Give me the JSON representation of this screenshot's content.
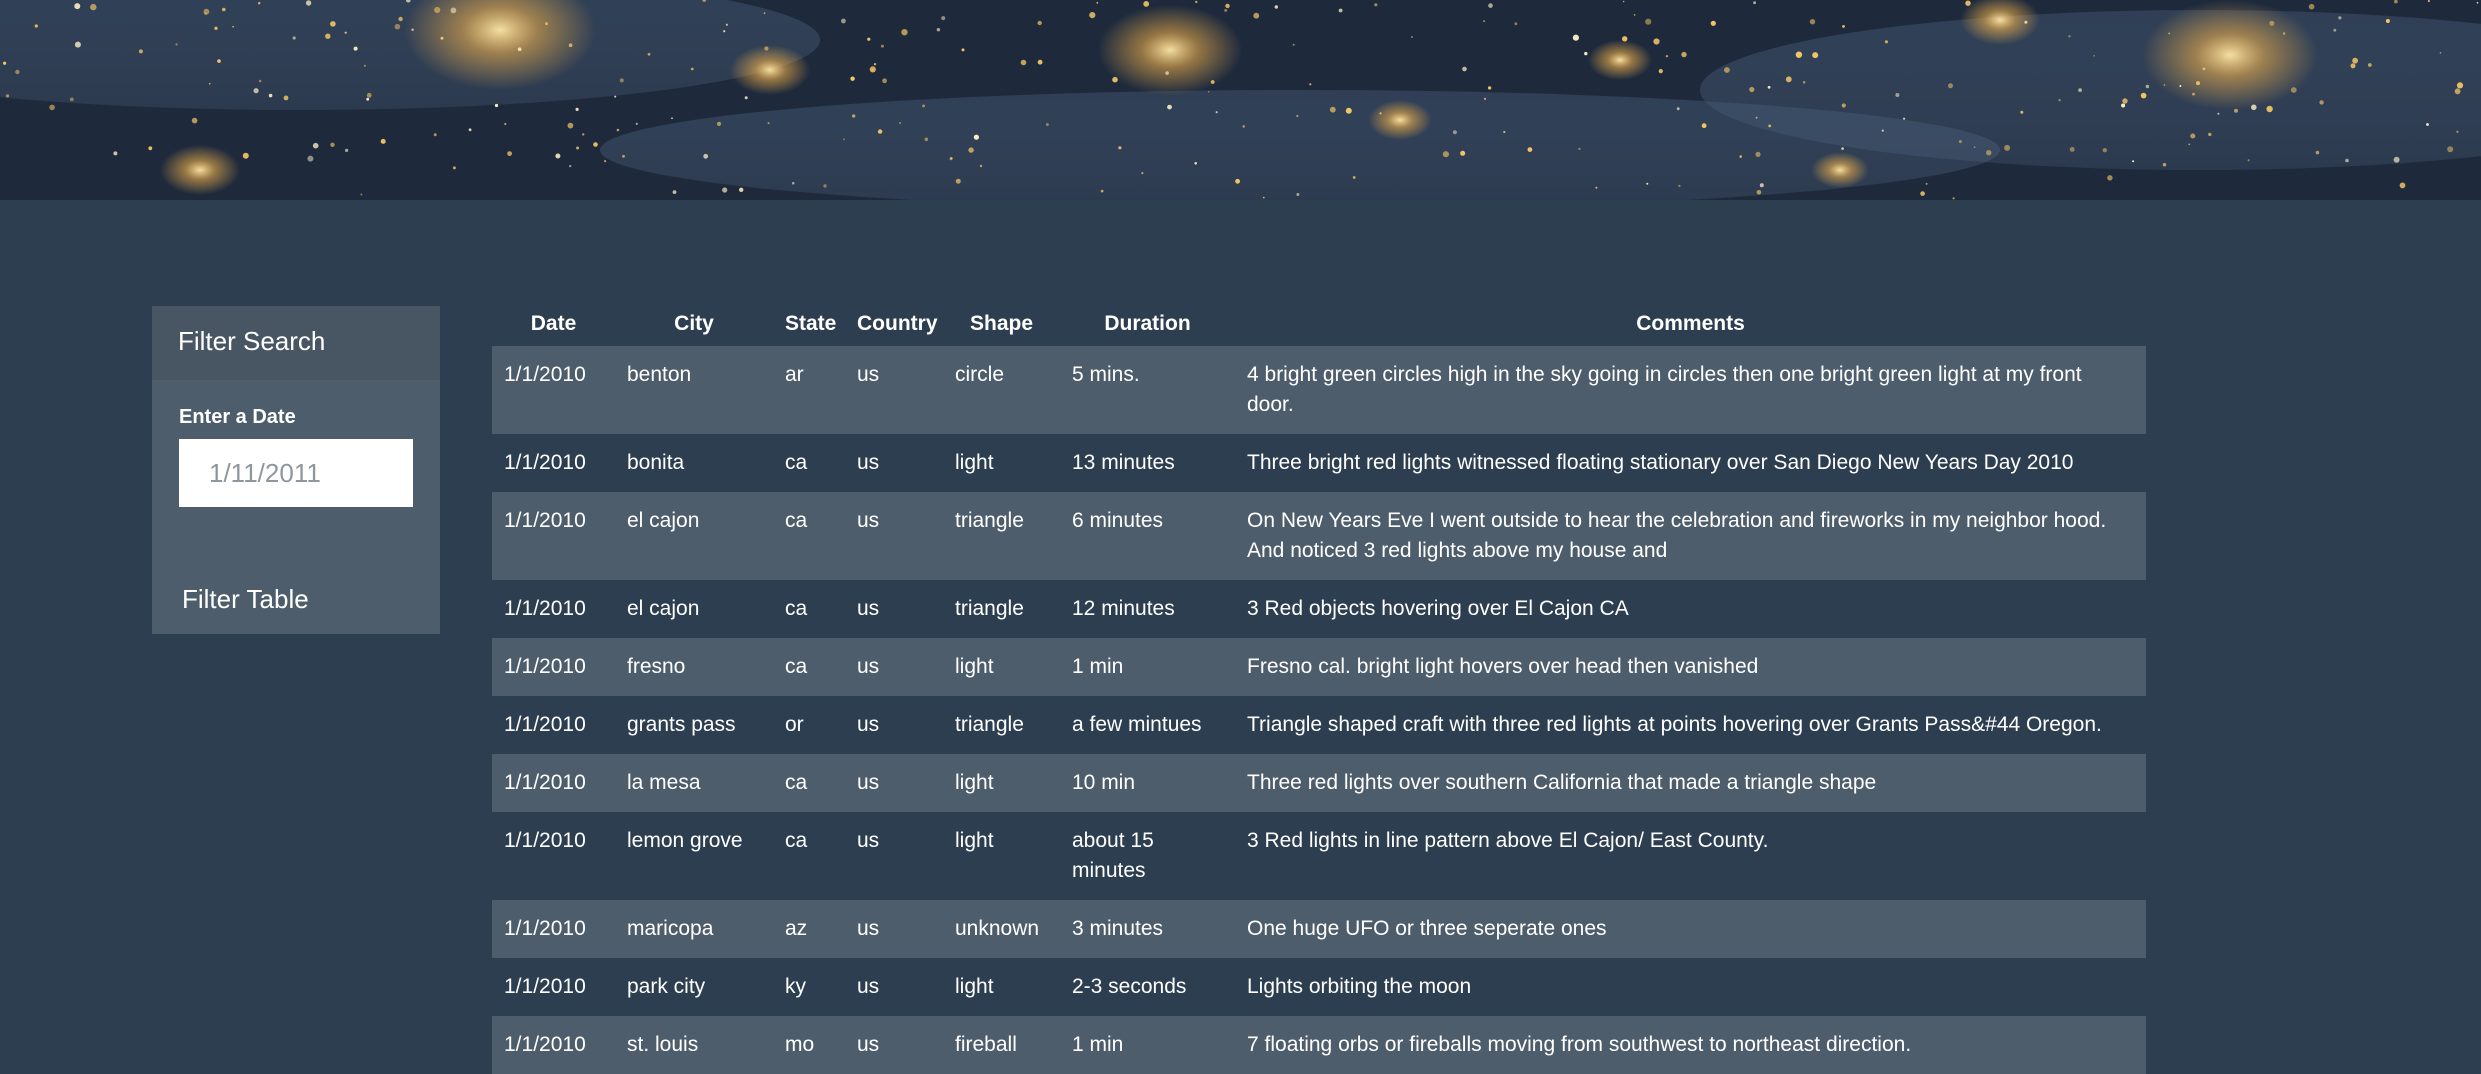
{
  "colors": {
    "page_background": "#2c3e50",
    "panel_background": "#4e5d6c",
    "row_alt": "#4e5d6c",
    "text": "#ffffff"
  },
  "hero": {
    "image": "night-earth-city-lights"
  },
  "filter": {
    "heading": "Filter Search",
    "label": "Enter a Date",
    "placeholder": "1/11/2011",
    "button_label": "Filter Table"
  },
  "table": {
    "headers": {
      "date": "Date",
      "city": "City",
      "state": "State",
      "country": "Country",
      "shape": "Shape",
      "duration": "Duration",
      "comments": "Comments"
    },
    "rows": [
      {
        "date": "1/1/2010",
        "city": "benton",
        "state": "ar",
        "country": "us",
        "shape": "circle",
        "duration": "5 mins.",
        "comments": "4 bright green circles high in the sky going in circles then one bright green light at my front door."
      },
      {
        "date": "1/1/2010",
        "city": "bonita",
        "state": "ca",
        "country": "us",
        "shape": "light",
        "duration": "13 minutes",
        "comments": "Three bright red lights witnessed floating stationary over San Diego New Years Day 2010"
      },
      {
        "date": "1/1/2010",
        "city": "el cajon",
        "state": "ca",
        "country": "us",
        "shape": "triangle",
        "duration": "6 minutes",
        "comments": "On New Years Eve I went outside to hear the celebration and fireworks in my neighbor hood. And noticed 3 red lights above my house and"
      },
      {
        "date": "1/1/2010",
        "city": "el cajon",
        "state": "ca",
        "country": "us",
        "shape": "triangle",
        "duration": "12 minutes",
        "comments": "3 Red objects hovering over El Cajon CA"
      },
      {
        "date": "1/1/2010",
        "city": "fresno",
        "state": "ca",
        "country": "us",
        "shape": "light",
        "duration": "1 min",
        "comments": "Fresno cal. bright light hovers over head then vanished"
      },
      {
        "date": "1/1/2010",
        "city": "grants pass",
        "state": "or",
        "country": "us",
        "shape": "triangle",
        "duration": "a few mintues",
        "comments": "Triangle shaped craft with three red lights at points hovering over Grants Pass&#44 Oregon."
      },
      {
        "date": "1/1/2010",
        "city": "la mesa",
        "state": "ca",
        "country": "us",
        "shape": "light",
        "duration": "10 min",
        "comments": "Three red lights over southern California that made a triangle shape"
      },
      {
        "date": "1/1/2010",
        "city": "lemon grove",
        "state": "ca",
        "country": "us",
        "shape": "light",
        "duration": "about 15 minutes",
        "comments": "3 Red lights in line pattern above El Cajon/ East County."
      },
      {
        "date": "1/1/2010",
        "city": "maricopa",
        "state": "az",
        "country": "us",
        "shape": "unknown",
        "duration": "3 minutes",
        "comments": "One huge UFO or three seperate ones"
      },
      {
        "date": "1/1/2010",
        "city": "park city",
        "state": "ky",
        "country": "us",
        "shape": "light",
        "duration": "2-3 seconds",
        "comments": "Lights orbiting the moon"
      },
      {
        "date": "1/1/2010",
        "city": "st. louis",
        "state": "mo",
        "country": "us",
        "shape": "fireball",
        "duration": "1 min",
        "comments": "7 floating orbs or fireballs moving from southwest to northeast direction."
      }
    ]
  }
}
